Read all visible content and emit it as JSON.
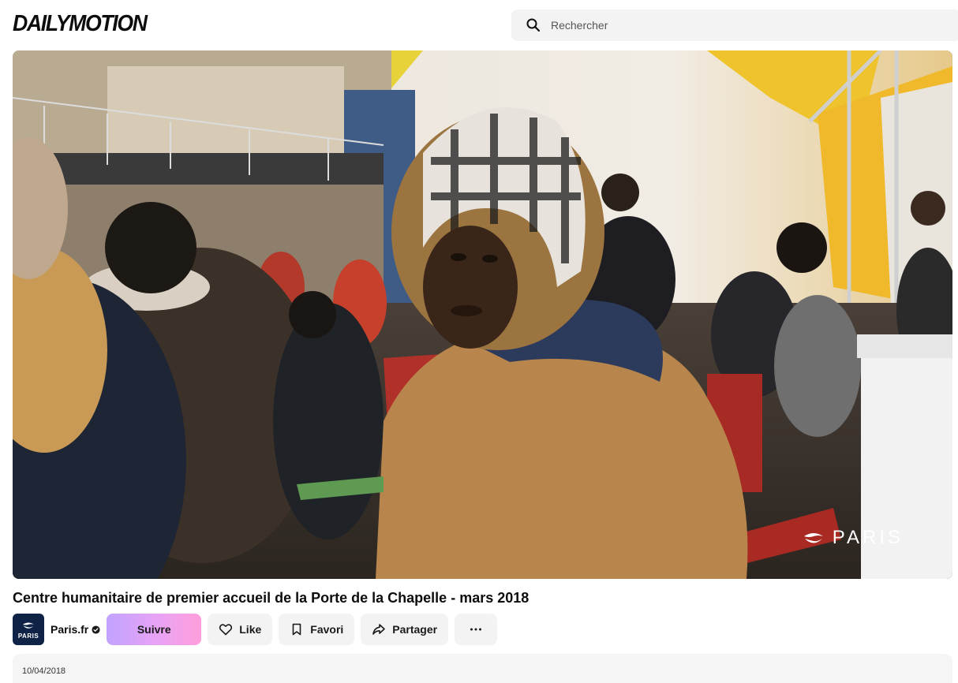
{
  "header": {
    "logo": "DAILYMOTION",
    "search_placeholder": "Rechercher"
  },
  "player": {
    "watermark": "PARIS"
  },
  "video": {
    "title": "Centre humanitaire de premier accueil de la Porte de la Chapelle - mars 2018",
    "date": "10/04/2018"
  },
  "channel": {
    "avatar_text": "PARIS",
    "name": "Paris.fr",
    "verified_icon": "verified-badge-icon"
  },
  "actions": {
    "follow": "Suivre",
    "like": "Like",
    "favorite": "Favori",
    "share": "Partager",
    "more": "more-horizontal-icon"
  },
  "colors": {
    "follow_gradient_start": "#c1a3ff",
    "follow_gradient_end": "#ff9edb",
    "button_bg": "#f3f3f4",
    "avatar_bg": "#0f2346"
  }
}
